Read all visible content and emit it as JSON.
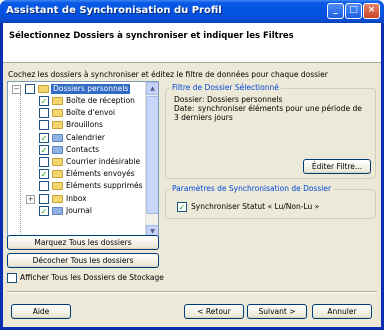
{
  "window": {
    "title": "Assistant de Synchronisation du Profil"
  },
  "header": {
    "title": "Sélectionnez Dossiers à synchroniser et indiquer les Filtres"
  },
  "instruction": "Cochez les dossiers à synchroniser et éditez le filtre de données pour chaque dossier",
  "tree": {
    "root": {
      "label": "Dossiers personnels",
      "checked": false,
      "selected": true
    },
    "items": [
      {
        "label": "Boîte de réception",
        "checked": true,
        "expander": null,
        "icon": "folder-icon"
      },
      {
        "label": "Boîte d'envoi",
        "checked": false,
        "expander": null,
        "icon": "folder-icon"
      },
      {
        "label": "Brouillons",
        "checked": false,
        "expander": null,
        "icon": "folder-icon"
      },
      {
        "label": "Calendrier",
        "checked": true,
        "expander": null,
        "icon": "calendar-icon"
      },
      {
        "label": "Contacts",
        "checked": true,
        "expander": null,
        "icon": "contacts-icon"
      },
      {
        "label": "Courrier indésirable",
        "checked": false,
        "expander": null,
        "icon": "folder-icon"
      },
      {
        "label": "Éléments envoyés",
        "checked": true,
        "expander": null,
        "icon": "folder-icon"
      },
      {
        "label": "Éléments supprimés",
        "checked": false,
        "expander": null,
        "icon": "folder-icon"
      },
      {
        "label": "Inbox",
        "checked": false,
        "expander": "+",
        "icon": "folder-icon"
      },
      {
        "label": "Journal",
        "checked": true,
        "expander": null,
        "icon": "journal-icon"
      }
    ]
  },
  "buttons": {
    "mark_all": "Marquez Tous les dossiers",
    "unmark_all": "Décocher Tous les dossiers",
    "edit_filter": "Éditer Filtre...",
    "help": "Aide",
    "back": "< Retour",
    "next": "Suivant >",
    "cancel": "Annuler"
  },
  "show_storage": {
    "label": "Afficher Tous les Dossiers de Stockage",
    "checked": false
  },
  "filter_group": {
    "title": "Filtre de Dossier Sélectionné",
    "folder_label": "Dossier:",
    "folder_value": "Dossiers personnels",
    "date_label": "Date:",
    "date_value_line1": "synchroniser éléments pour une période de",
    "date_value_line2": "3 derniers jours"
  },
  "sync_group": {
    "title": "Paramètres de Synchronisation de Dossier",
    "sync_status": {
      "label": "Synchroniser Statut « Lu/Non-Lu »",
      "checked": true
    }
  },
  "colors": {
    "title_bar": "#0054e3",
    "selection": "#316ac5",
    "group_title": "#0046d5",
    "dialog_bg": "#ece9d8"
  }
}
